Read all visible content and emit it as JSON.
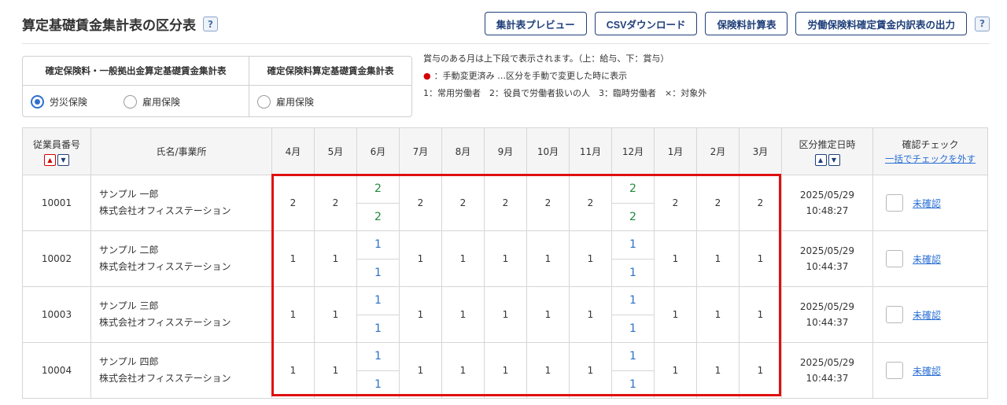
{
  "header": {
    "title": "算定基礎賃金集計表の区分表",
    "help": "?",
    "buttons": [
      "集計表プレビュー",
      "CSVダウンロード",
      "保険料計算表",
      "労働保険料確定賃金内訳表の出力"
    ]
  },
  "selector": {
    "col1_title": "確定保険料・一般拠出金算定基礎賃金集計表",
    "col1_options": [
      "労災保険",
      "雇用保険"
    ],
    "col2_title": "確定保険料算定基礎賃金集計表",
    "col2_options": [
      "雇用保険"
    ],
    "selected": "労災保険"
  },
  "legend": {
    "line1": "賞与のある月は上下段で表示されます。（上：給与、下：賞与）",
    "bullet": "●",
    "line2": "：手動変更済み …区分を手動で変更した時に表示",
    "line3": "1：常用労働者　2：役員で労働者扱いの人　3：臨時労働者　×：対象外"
  },
  "table": {
    "col_emp": "従業員番号",
    "col_name": "氏名/事業所",
    "months": [
      "4月",
      "5月",
      "6月",
      "7月",
      "8月",
      "9月",
      "10月",
      "11月",
      "12月",
      "1月",
      "2月",
      "3月"
    ],
    "col_date": "区分推定日時",
    "col_check": "確認チェック",
    "bulk_uncheck": "一括でチェックを外す",
    "sort_up": "▲",
    "sort_down": "▼",
    "rows": [
      {
        "id": "10001",
        "name": "サンプル 一郎",
        "office": "株式会社オフィスステーション",
        "values": [
          "2",
          "2",
          [
            "2",
            "2"
          ],
          "2",
          "2",
          "2",
          "2",
          "2",
          [
            "2",
            "2"
          ],
          "2",
          "2",
          "2"
        ],
        "date": "2025/05/29",
        "time": "10:48:27",
        "status": "未確認"
      },
      {
        "id": "10002",
        "name": "サンプル 二郎",
        "office": "株式会社オフィスステーション",
        "values": [
          "1",
          "1",
          [
            "1",
            "1"
          ],
          "1",
          "1",
          "1",
          "1",
          "1",
          [
            "1",
            "1"
          ],
          "1",
          "1",
          "1"
        ],
        "date": "2025/05/29",
        "time": "10:44:37",
        "status": "未確認"
      },
      {
        "id": "10003",
        "name": "サンプル 三郎",
        "office": "株式会社オフィスステーション",
        "values": [
          "1",
          "1",
          [
            "1",
            "1"
          ],
          "1",
          "1",
          "1",
          "1",
          "1",
          [
            "1",
            "1"
          ],
          "1",
          "1",
          "1"
        ],
        "date": "2025/05/29",
        "time": "10:44:37",
        "status": "未確認"
      },
      {
        "id": "10004",
        "name": "サンプル 四郎",
        "office": "株式会社オフィスステーション",
        "values": [
          "1",
          "1",
          [
            "1",
            "1"
          ],
          "1",
          "1",
          "1",
          "1",
          "1",
          [
            "1",
            "1"
          ],
          "1",
          "1",
          "1"
        ],
        "date": "2025/05/29",
        "time": "10:44:37",
        "status": "未確認"
      }
    ]
  },
  "colors": {
    "accent": "#1f3f7a",
    "value_2": "#1f8a3c",
    "value_1": "#2a72c4",
    "highlight": "#e01010"
  }
}
